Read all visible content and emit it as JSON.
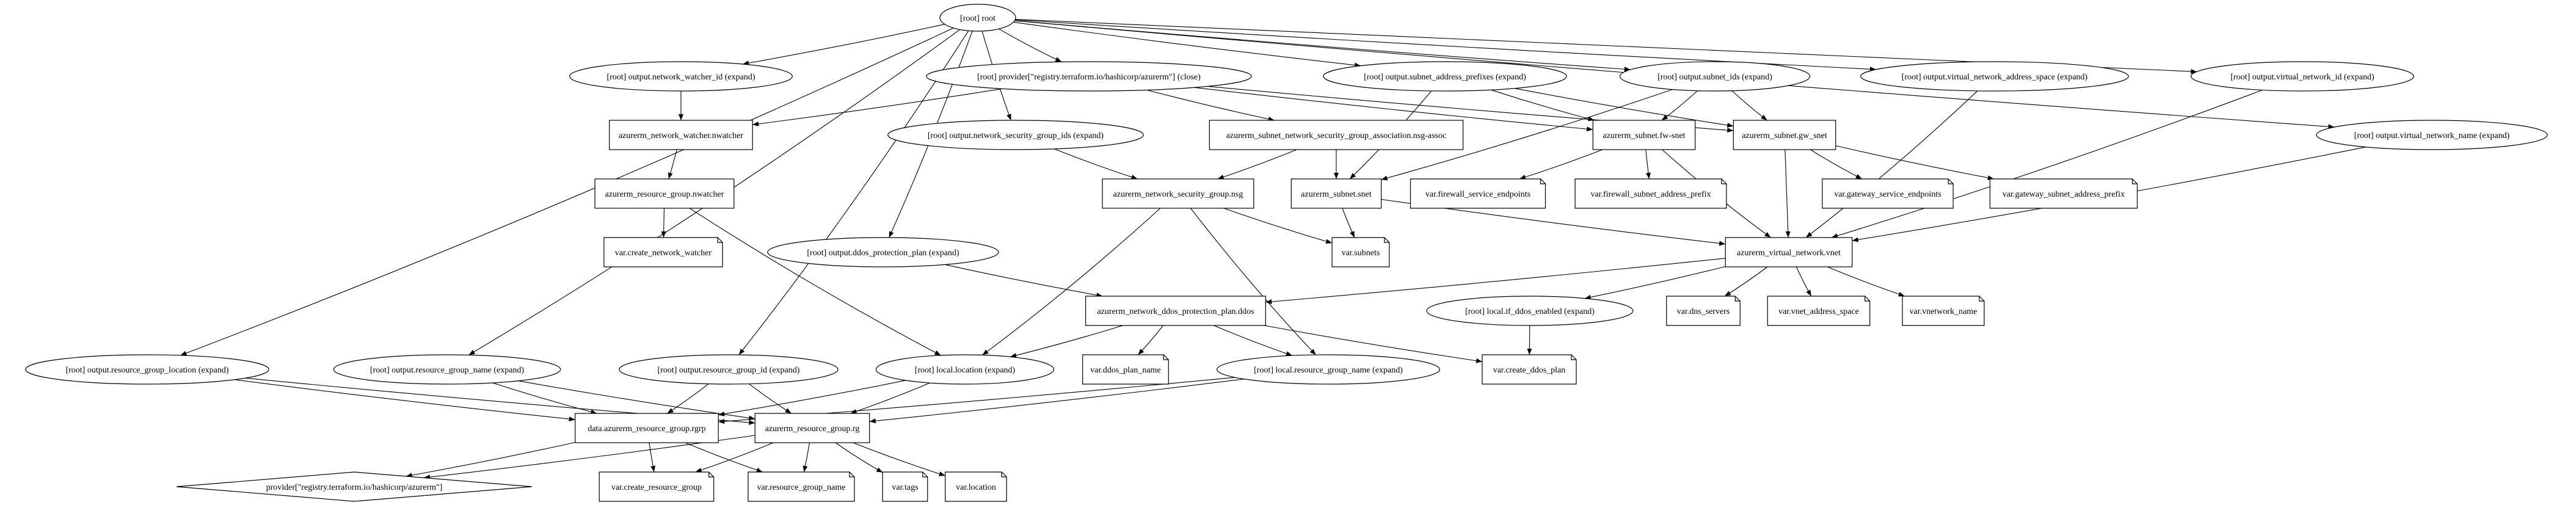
{
  "graph": {
    "type": "terraform-dependency-graph",
    "nodes": [
      {
        "id": "root",
        "label": "[root] root",
        "shape": "ellipse"
      },
      {
        "id": "out_nw_id",
        "label": "[root] output.network_watcher_id (expand)",
        "shape": "ellipse"
      },
      {
        "id": "provider_close",
        "label": "[root] provider[\"registry.terraform.io/hashicorp/azurerm\"] (close)",
        "shape": "ellipse"
      },
      {
        "id": "out_subnet_prefixes",
        "label": "[root] output.subnet_address_prefixes (expand)",
        "shape": "ellipse"
      },
      {
        "id": "out_subnet_ids",
        "label": "[root] output.subnet_ids (expand)",
        "shape": "ellipse"
      },
      {
        "id": "out_vnet_space",
        "label": "[root] output.virtual_network_address_space (expand)",
        "shape": "ellipse"
      },
      {
        "id": "out_vnet_id",
        "label": "[root] output.virtual_network_id (expand)",
        "shape": "ellipse"
      },
      {
        "id": "nwatcher",
        "label": "azurerm_network_watcher.nwatcher",
        "shape": "box"
      },
      {
        "id": "out_nsg_ids",
        "label": "[root] output.network_security_group_ids (expand)",
        "shape": "ellipse"
      },
      {
        "id": "nsg_assoc",
        "label": "azurerm_subnet_network_security_group_association.nsg-assoc",
        "shape": "box"
      },
      {
        "id": "fw_snet",
        "label": "azurerm_subnet.fw-snet",
        "shape": "box"
      },
      {
        "id": "gw_snet",
        "label": "azurerm_subnet.gw_snet",
        "shape": "box"
      },
      {
        "id": "out_vnet_name",
        "label": "[root] output.virtual_network_name (expand)",
        "shape": "ellipse"
      },
      {
        "id": "rg_nwatcher",
        "label": "azurerm_resource_group.nwatcher",
        "shape": "box"
      },
      {
        "id": "nsg",
        "label": "azurerm_network_security_group.nsg",
        "shape": "box"
      },
      {
        "id": "snet",
        "label": "azurerm_subnet.snet",
        "shape": "box"
      },
      {
        "id": "v_fw_se",
        "label": "var.firewall_service_endpoints",
        "shape": "note"
      },
      {
        "id": "v_fw_prefix",
        "label": "var.firewall_subnet_address_prefix",
        "shape": "note"
      },
      {
        "id": "v_gw_se",
        "label": "var.gateway_service_endpoints",
        "shape": "note"
      },
      {
        "id": "v_gw_prefix",
        "label": "var.gateway_subnet_address_prefix",
        "shape": "note"
      },
      {
        "id": "v_create_nw",
        "label": "var.create_network_watcher",
        "shape": "note"
      },
      {
        "id": "out_ddos",
        "label": "[root] output.ddos_protection_plan (expand)",
        "shape": "ellipse"
      },
      {
        "id": "v_subnets",
        "label": "var.subnets",
        "shape": "note"
      },
      {
        "id": "vnet",
        "label": "azurerm_virtual_network.vnet",
        "shape": "box"
      },
      {
        "id": "ddos",
        "label": "azurerm_network_ddos_protection_plan.ddos",
        "shape": "box"
      },
      {
        "id": "l_if_ddos",
        "label": "[root] local.if_ddos_enabled (expand)",
        "shape": "ellipse"
      },
      {
        "id": "v_dns",
        "label": "var.dns_servers",
        "shape": "note"
      },
      {
        "id": "v_vnet_space",
        "label": "var.vnet_address_space",
        "shape": "note"
      },
      {
        "id": "v_vnet_name",
        "label": "var.vnetwork_name",
        "shape": "note"
      },
      {
        "id": "out_rg_loc",
        "label": "[root] output.resource_group_location (expand)",
        "shape": "ellipse"
      },
      {
        "id": "out_rg_name",
        "label": "[root] output.resource_group_name (expand)",
        "shape": "ellipse"
      },
      {
        "id": "out_rg_id",
        "label": "[root] output.resource_group_id (expand)",
        "shape": "ellipse"
      },
      {
        "id": "l_location",
        "label": "[root] local.location (expand)",
        "shape": "ellipse"
      },
      {
        "id": "v_ddos_name",
        "label": "var.ddos_plan_name",
        "shape": "note"
      },
      {
        "id": "l_rg_name",
        "label": "[root] local.resource_group_name (expand)",
        "shape": "ellipse"
      },
      {
        "id": "v_create_ddos",
        "label": "var.create_ddos_plan",
        "shape": "note"
      },
      {
        "id": "rgrp",
        "label": "data.azurerm_resource_group.rgrp",
        "shape": "box"
      },
      {
        "id": "rg",
        "label": "azurerm_resource_group.rg",
        "shape": "box"
      },
      {
        "id": "provider",
        "label": "provider[\"registry.terraform.io/hashicorp/azurerm\"]",
        "shape": "diamond"
      },
      {
        "id": "v_create_rg",
        "label": "var.create_resource_group",
        "shape": "note"
      },
      {
        "id": "v_rg_name",
        "label": "var.resource_group_name",
        "shape": "note"
      },
      {
        "id": "v_tags",
        "label": "var.tags",
        "shape": "note"
      },
      {
        "id": "v_location",
        "label": "var.location",
        "shape": "note"
      }
    ],
    "edges": [
      [
        "root",
        "out_nw_id"
      ],
      [
        "root",
        "provider_close"
      ],
      [
        "root",
        "out_subnet_prefixes"
      ],
      [
        "root",
        "out_subnet_ids"
      ],
      [
        "root",
        "out_vnet_space"
      ],
      [
        "root",
        "out_vnet_id"
      ],
      [
        "root",
        "out_vnet_name"
      ],
      [
        "root",
        "out_nsg_ids"
      ],
      [
        "root",
        "out_ddos"
      ],
      [
        "root",
        "out_rg_loc"
      ],
      [
        "root",
        "out_rg_name"
      ],
      [
        "root",
        "out_rg_id"
      ],
      [
        "out_nw_id",
        "nwatcher"
      ],
      [
        "provider_close",
        "nwatcher"
      ],
      [
        "provider_close",
        "nsg_assoc"
      ],
      [
        "provider_close",
        "fw_snet"
      ],
      [
        "provider_close",
        "gw_snet"
      ],
      [
        "out_subnet_prefixes",
        "snet"
      ],
      [
        "out_subnet_prefixes",
        "fw_snet"
      ],
      [
        "out_subnet_prefixes",
        "gw_snet"
      ],
      [
        "out_subnet_ids",
        "snet"
      ],
      [
        "out_subnet_ids",
        "fw_snet"
      ],
      [
        "out_subnet_ids",
        "gw_snet"
      ],
      [
        "out_vnet_space",
        "vnet"
      ],
      [
        "out_vnet_id",
        "vnet"
      ],
      [
        "out_vnet_name",
        "vnet"
      ],
      [
        "nwatcher",
        "rg_nwatcher"
      ],
      [
        "out_nsg_ids",
        "nsg"
      ],
      [
        "nsg_assoc",
        "nsg"
      ],
      [
        "nsg_assoc",
        "snet"
      ],
      [
        "fw_snet",
        "v_fw_se"
      ],
      [
        "fw_snet",
        "v_fw_prefix"
      ],
      [
        "fw_snet",
        "vnet"
      ],
      [
        "gw_snet",
        "v_gw_se"
      ],
      [
        "gw_snet",
        "v_gw_prefix"
      ],
      [
        "gw_snet",
        "vnet"
      ],
      [
        "rg_nwatcher",
        "v_create_nw"
      ],
      [
        "rg_nwatcher",
        "l_location"
      ],
      [
        "nsg",
        "v_subnets"
      ],
      [
        "nsg",
        "l_location"
      ],
      [
        "nsg",
        "l_rg_name"
      ],
      [
        "snet",
        "v_subnets"
      ],
      [
        "snet",
        "vnet"
      ],
      [
        "out_ddos",
        "ddos"
      ],
      [
        "vnet",
        "ddos"
      ],
      [
        "vnet",
        "l_if_ddos"
      ],
      [
        "vnet",
        "v_dns"
      ],
      [
        "vnet",
        "v_vnet_space"
      ],
      [
        "vnet",
        "v_vnet_name"
      ],
      [
        "ddos",
        "l_location"
      ],
      [
        "ddos",
        "v_ddos_name"
      ],
      [
        "ddos",
        "l_rg_name"
      ],
      [
        "ddos",
        "v_create_ddos"
      ],
      [
        "l_if_ddos",
        "v_create_ddos"
      ],
      [
        "out_rg_loc",
        "rgrp"
      ],
      [
        "out_rg_loc",
        "rg"
      ],
      [
        "out_rg_name",
        "rgrp"
      ],
      [
        "out_rg_name",
        "rg"
      ],
      [
        "out_rg_id",
        "rgrp"
      ],
      [
        "out_rg_id",
        "rg"
      ],
      [
        "l_location",
        "rgrp"
      ],
      [
        "l_location",
        "rg"
      ],
      [
        "l_rg_name",
        "rgrp"
      ],
      [
        "l_rg_name",
        "rg"
      ],
      [
        "rgrp",
        "provider"
      ],
      [
        "rgrp",
        "v_create_rg"
      ],
      [
        "rgrp",
        "v_rg_name"
      ],
      [
        "rg",
        "provider"
      ],
      [
        "rg",
        "v_create_rg"
      ],
      [
        "rg",
        "v_rg_name"
      ],
      [
        "rg",
        "v_tags"
      ],
      [
        "rg",
        "v_location"
      ]
    ]
  }
}
